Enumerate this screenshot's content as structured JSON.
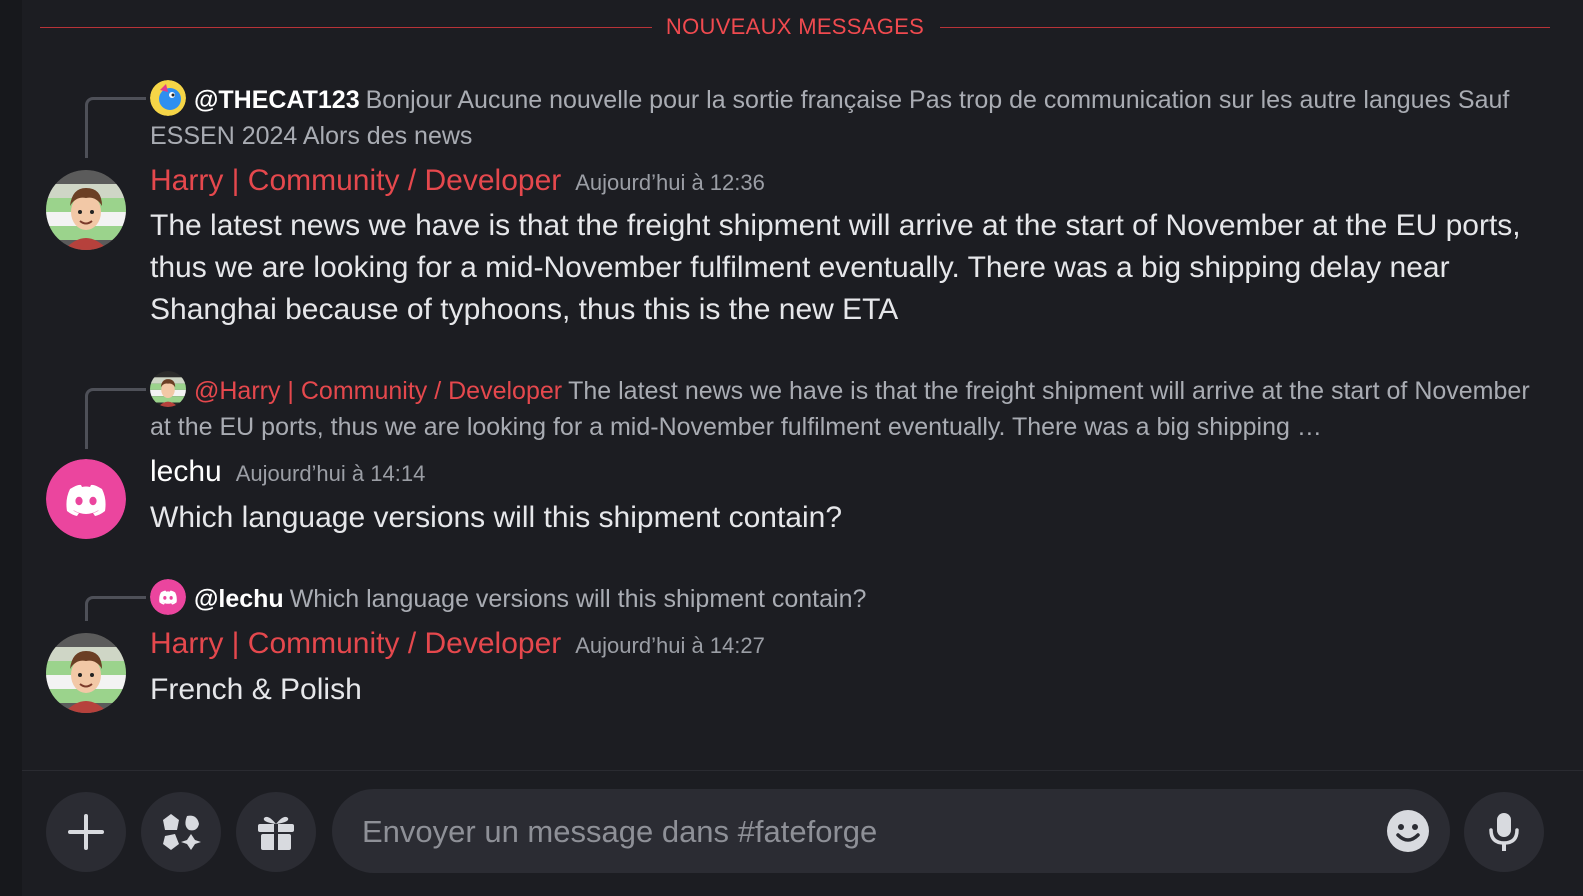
{
  "new_messages_label": "NOUVEAUX MESSAGES",
  "messages": [
    {
      "reply": {
        "mention": "@THECAT123",
        "text": "Bonjour  Aucune nouvelle pour la sortie française  Pas trop de communication sur les autre langues Sauf ESSEN 2024 Alors des news"
      },
      "author": "Harry | Community / Developer",
      "author_color": "#e5484d",
      "timestamp": "Aujourd’hui à 12:36",
      "content": "The latest news we have is that the freight shipment will arrive at the start of November at the EU ports, thus we are looking for a mid-November fulfilment eventually. There was a big shipping delay near Shanghai because of typhoons, thus this is the new ETA"
    },
    {
      "reply": {
        "mention": "@Harry | Community / Developer",
        "text": "The latest news we have is that the freight shipment will arrive at the start of November at the EU ports, thus we are looking for a mid-November fulfilment eventually. There was a big shipping …"
      },
      "author": "lechu",
      "author_color": "#ffffff",
      "timestamp": "Aujourd’hui à 14:14",
      "content": "Which language versions will this shipment contain?"
    },
    {
      "reply": {
        "mention": "@lechu",
        "text": "Which language versions will this shipment contain?"
      },
      "author": "Harry | Community / Developer",
      "author_color": "#e5484d",
      "timestamp": "Aujourd’hui à 14:27",
      "content": "French & Polish"
    }
  ],
  "composer": {
    "placeholder": "Envoyer un message dans #fateforge",
    "buttons": [
      "plus-icon",
      "apps-icon",
      "gift-icon",
      "emoji-icon",
      "microphone-icon"
    ]
  },
  "colors": {
    "background": "#1c1d22",
    "accent_red": "#e5484d",
    "discord_pink": "#eb459e"
  }
}
